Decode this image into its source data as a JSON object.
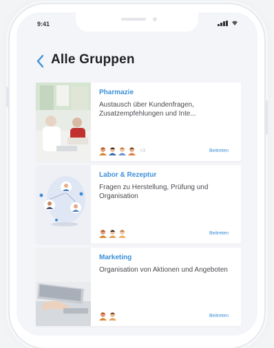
{
  "status_bar": {
    "time": "9:41"
  },
  "header": {
    "title": "Alle Gruppen",
    "back_icon": "chevron-left-icon"
  },
  "groups": [
    {
      "title": "Pharmazie",
      "description": "Austausch über Kundenfragen, Zusatzempfehlungen und Inte...",
      "members_more": "+3",
      "join_label": "Beitreten"
    },
    {
      "title": "Labor & Rezeptur",
      "description": "Fragen zu Herstellung, Prüfung und Organisation",
      "members_more": "",
      "join_label": "Beitreten"
    },
    {
      "title": "Marketing",
      "description": "Organisation von Aktionen und Angeboten",
      "members_more": "",
      "join_label": "Beitreten"
    }
  ],
  "colors": {
    "accent": "#3a8fd8",
    "background": "#f4f5f8",
    "card": "#ffffff"
  }
}
